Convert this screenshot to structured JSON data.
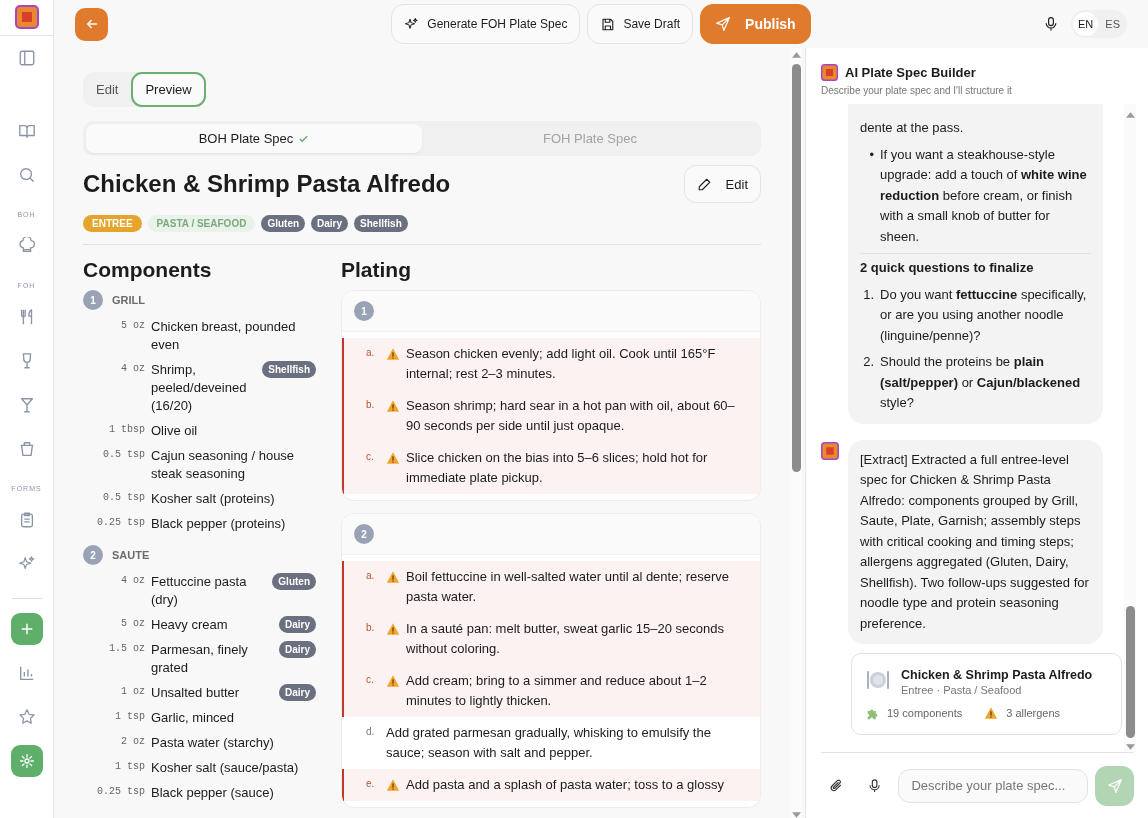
{
  "top_bar": {
    "buttons": [
      {
        "label": "Generate FOH Plate Spec",
        "kind": "generate"
      },
      {
        "label": "Save Draft",
        "kind": "save"
      },
      {
        "label": "Publish",
        "kind": "publish"
      }
    ],
    "languages": [
      {
        "label": "EN",
        "selected": true
      },
      {
        "label": "ES",
        "selected": false
      }
    ]
  },
  "sidebar": {
    "section_labels": [
      "BOH",
      "FOH",
      "FORMS"
    ]
  },
  "view_toggle": [
    {
      "label": "Edit",
      "selected": false
    },
    {
      "label": "Preview",
      "selected": true
    }
  ],
  "spec_tabs": [
    {
      "label": "BOH Plate Spec",
      "selected": true,
      "done": true
    },
    {
      "label": "FOH Plate Spec",
      "selected": false,
      "done": false
    }
  ],
  "title": "Chicken & Shrimp Pasta Alfredo",
  "edit_button": "Edit",
  "tags": [
    {
      "label": "ENTREE",
      "kind": "category"
    },
    {
      "label": "PASTA / SEAFOOD",
      "kind": "subcategory"
    },
    {
      "label": "Gluten",
      "kind": "allergen"
    },
    {
      "label": "Dairy",
      "kind": "allergen"
    },
    {
      "label": "Shellfish",
      "kind": "allergen"
    }
  ],
  "components": {
    "heading": "Components",
    "groups": [
      {
        "number": "1",
        "name": "GRILL",
        "items": [
          {
            "qty": "5",
            "unit": "oz",
            "name": "Chicken breast, pounded even"
          },
          {
            "qty": "4",
            "unit": "oz",
            "name": "Shrimp, peeled/deveined (16/20)",
            "allergen": "Shellfish"
          },
          {
            "qty": "1",
            "unit": "tbsp",
            "name": "Olive oil"
          },
          {
            "qty": "0.5",
            "unit": "tsp",
            "name": "Cajun seasoning / house steak seasoning"
          },
          {
            "qty": "0.5",
            "unit": "tsp",
            "name": "Kosher salt (proteins)"
          },
          {
            "qty": "0.25",
            "unit": "tsp",
            "name": "Black pepper (proteins)"
          }
        ]
      },
      {
        "number": "2",
        "name": "SAUTE",
        "items": [
          {
            "qty": "4",
            "unit": "oz",
            "name": "Fettuccine pasta (dry)",
            "allergen": "Gluten"
          },
          {
            "qty": "5",
            "unit": "oz",
            "name": "Heavy cream",
            "allergen": "Dairy"
          },
          {
            "qty": "1.5",
            "unit": "oz",
            "name": "Parmesan, finely grated",
            "allergen": "Dairy"
          },
          {
            "qty": "1",
            "unit": "oz",
            "name": "Unsalted butter",
            "allergen": "Dairy"
          },
          {
            "qty": "1",
            "unit": "tsp",
            "name": "Garlic, minced"
          },
          {
            "qty": "2",
            "unit": "oz",
            "name": "Pasta water (starchy)"
          },
          {
            "qty": "1",
            "unit": "tsp",
            "name": "Kosher salt (sauce/pasta)"
          },
          {
            "qty": "0.25",
            "unit": "tsp",
            "name": "Black pepper (sauce)"
          }
        ]
      }
    ]
  },
  "plating": {
    "heading": "Plating",
    "steps": [
      {
        "number": "1",
        "substeps": [
          {
            "letter": "a.",
            "text": "Season chicken evenly; add light oil. Cook until 165°F internal; rest 2–3 minutes.",
            "critical": true
          },
          {
            "letter": "b.",
            "text": "Season shrimp; hard sear in a hot pan with oil, about 60–90 seconds per side until just opaque.",
            "critical": true
          },
          {
            "letter": "c.",
            "text": "Slice chicken on the bias into 5–6 slices; hold hot for immediate plate pickup.",
            "critical": true
          }
        ]
      },
      {
        "number": "2",
        "substeps": [
          {
            "letter": "a.",
            "text": "Boil fettuccine in well-salted water until al dente; reserve pasta water.",
            "critical": true
          },
          {
            "letter": "b.",
            "text": "In a sauté pan: melt butter, sweat garlic 15–20 seconds without coloring.",
            "critical": true
          },
          {
            "letter": "c.",
            "text": "Add cream; bring to a simmer and reduce about 1–2 minutes to lightly thicken.",
            "critical": true
          },
          {
            "letter": "d.",
            "text": "Add grated parmesan gradually, whisking to emulsify the sauce; season with salt and pepper.",
            "critical": false
          },
          {
            "letter": "e.",
            "text": "Add pasta and a splash of pasta water; toss to a glossy",
            "critical": true
          }
        ]
      }
    ]
  },
  "chat": {
    "title": "AI Plate Spec Builder",
    "subtitle": "Describe your plate spec and I'll structure it",
    "reply": {
      "continued_text": "dente at the pass.",
      "bullets": [
        {
          "marker": "•",
          "text": "If you want a steakhouse-style upgrade: add a touch of **white wine reduction** before cream, or finish with a small knob of butter for sheen."
        }
      ],
      "heading": "2 quick questions to finalize",
      "questions": [
        {
          "marker": "1.",
          "text": "Do you want **fettuccine** specifically, or are you using another noodle (linguine/penne)?"
        },
        {
          "marker": "2.",
          "text": "Should the proteins be **plain (salt/pepper)** or **Cajun/blackened** style?"
        }
      ]
    },
    "summary": "[Extract] Extracted a full entree-level spec for Chicken & Shrimp Pasta Alfredo: components grouped by Grill, Saute, Plate, Garnish; assembly steps with critical cooking and timing steps; allergens aggregated (Gluten, Dairy, Shellfish). Two follow-ups suggested for noodle type and protein seasoning preference.",
    "card": {
      "title": "Chicken & Shrimp Pasta Alfredo",
      "subtitle": "Entree · Pasta / Seafood",
      "stats": [
        {
          "label": "19 components",
          "kind": "components"
        },
        {
          "label": "3 allergens",
          "kind": "allergens"
        }
      ]
    },
    "input": {
      "placeholder": "Describe your plate spec..."
    }
  }
}
